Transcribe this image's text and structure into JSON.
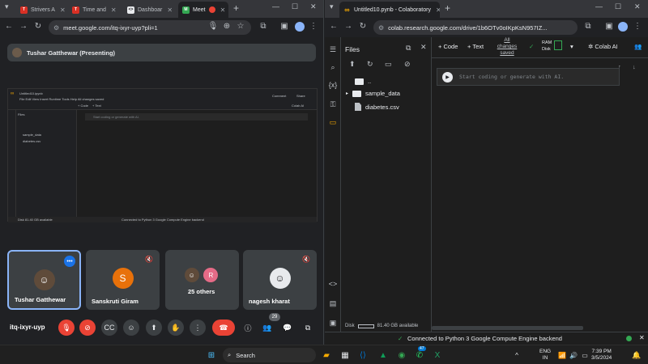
{
  "left_window": {
    "tabs": [
      {
        "title": "Strivers A",
        "color": "#d93025",
        "glyph": "TUF"
      },
      {
        "title": "Time and",
        "color": "#d93025",
        "glyph": "TUF"
      },
      {
        "title": "Dashboar",
        "color": "#e8eaed",
        "glyph": "<>"
      },
      {
        "title": "Meet",
        "color": "#34a853",
        "glyph": "M"
      }
    ],
    "url": "meet.google.com/itq-ixyr-uyp?pli=1",
    "presenting_label": "Tushar Gatthewar (Presenting)",
    "meeting_code": "itq-ixyr-uyp",
    "participant_count": "29",
    "tiles": [
      {
        "name": "Tushar Gatthewar",
        "initial": "",
        "avatar_color": "#5f4b3a"
      },
      {
        "name": "Sanskruti Giram",
        "initial": "S",
        "avatar_color": "#e8710a"
      },
      {
        "name": "25 others",
        "initial": "R",
        "avatar_color": "#e56b87"
      },
      {
        "name": "nagesh kharat",
        "initial": "",
        "avatar_color": "#e8eaed"
      }
    ],
    "shared": {
      "notebook": "Untitled10.ipynb",
      "menu": "File  Edit  View  Insert  Runtime  Tools  Help  All changes saved",
      "files": "Files",
      "folder1": "sample_data",
      "file1": "diabetes.csv",
      "placeholder": "Start coding or generate with AI.",
      "status": "Connected to Python 3 Google Compute Engine backend",
      "disk": "Disk     81.40 GB available",
      "code": "+ Code",
      "text": "+ Text",
      "comment": "Comment",
      "share": "Share",
      "colab_ai": "Colab AI"
    }
  },
  "right_window": {
    "tab_title": "Untitled10.pynb - Colaboratory",
    "url": "colab.research.google.com/drive/1b6OTv0oIKpKsN957IZ...",
    "add_code": "+ Code",
    "add_text": "+ Text",
    "saved_status": "All changes saved",
    "ram_label": "RAM",
    "disk_label": "Disk",
    "colab_ai": "Colab AI",
    "files_title": "Files",
    "parent_dir": "..",
    "folder": "sample_data",
    "file": "diabetes.csv",
    "cell_placeholder": "Start coding or generate with AI.",
    "disk_status": "Disk",
    "disk_available": "81.40 GB available",
    "status_text": "Connected to Python 3 Google Compute Engine backend"
  },
  "taskbar": {
    "search_placeholder": "Search",
    "lang_top": "ENG",
    "lang_bottom": "IN",
    "time": "7:39 PM",
    "date": "3/5/2024",
    "whatsapp_badge": "47"
  }
}
